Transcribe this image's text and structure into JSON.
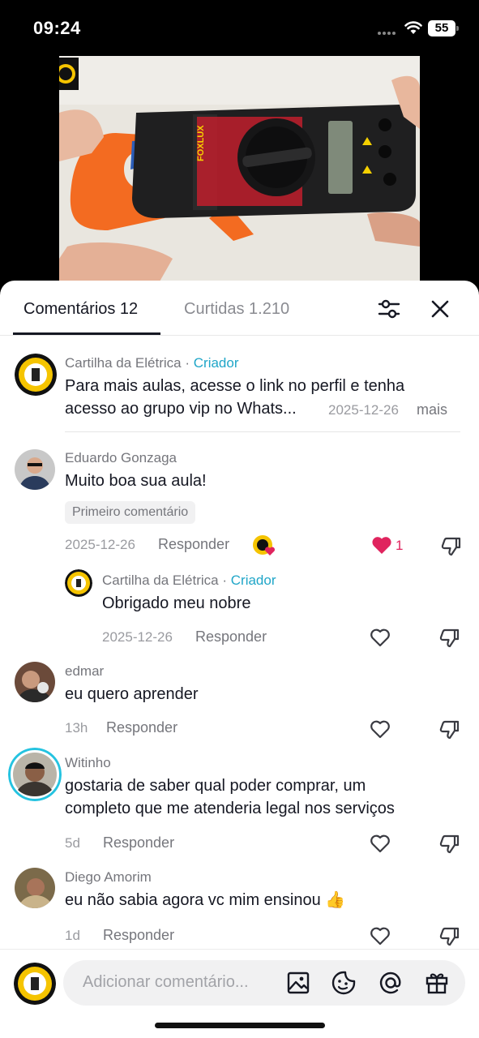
{
  "status_bar": {
    "time": "09:24",
    "battery": "55"
  },
  "tabs": {
    "comments_label": "Comentários 12",
    "likes_label": "Curtidas 1.210",
    "filter_icon": "sliders-icon",
    "close_icon": "close-icon"
  },
  "pinned": {
    "username": "Cartilha da Elétrica",
    "separator": "·",
    "badge": "Criador",
    "text_line1": "Para mais aulas, acesse o link no perfil e tenha",
    "text_line2": "acesso ao grupo vip no Whats...",
    "date": "2025-12-26",
    "more": "mais"
  },
  "comments": [
    {
      "username": "Eduardo Gonzaga",
      "text": "Muito boa sua aula!",
      "chip": "Primeiro comentário",
      "time": "2025-12-26",
      "reply_label": "Responder",
      "likes": "1",
      "liked": true,
      "reply": {
        "username": "Cartilha da Elétrica",
        "separator": "·",
        "badge": "Criador",
        "text": "Obrigado meu nobre",
        "time": "2025-12-26",
        "reply_label": "Responder"
      }
    },
    {
      "username": "edmar",
      "text": "eu quero aprender",
      "time": "13h",
      "reply_label": "Responder"
    },
    {
      "username": "Witinho",
      "text_line1": "gostaria de saber qual poder comprar, um",
      "text_line2": "completo que me atenderia legal nos serviços",
      "time": "5d",
      "reply_label": "Responder"
    },
    {
      "username": "Diego Amorim",
      "text": "eu não sabia agora vc mim ensinou 👍",
      "time": "1d",
      "reply_label": "Responder"
    }
  ],
  "input": {
    "placeholder": "Adicionar comentário...",
    "icons": [
      "image-icon",
      "sticker-icon",
      "mention-icon",
      "gift-icon"
    ]
  },
  "video": {
    "brand_text": "FOXLUX"
  },
  "colors": {
    "creator": "#20a6c8",
    "like_red": "#e0245e",
    "text": "#161823",
    "muted": "#75767c"
  }
}
